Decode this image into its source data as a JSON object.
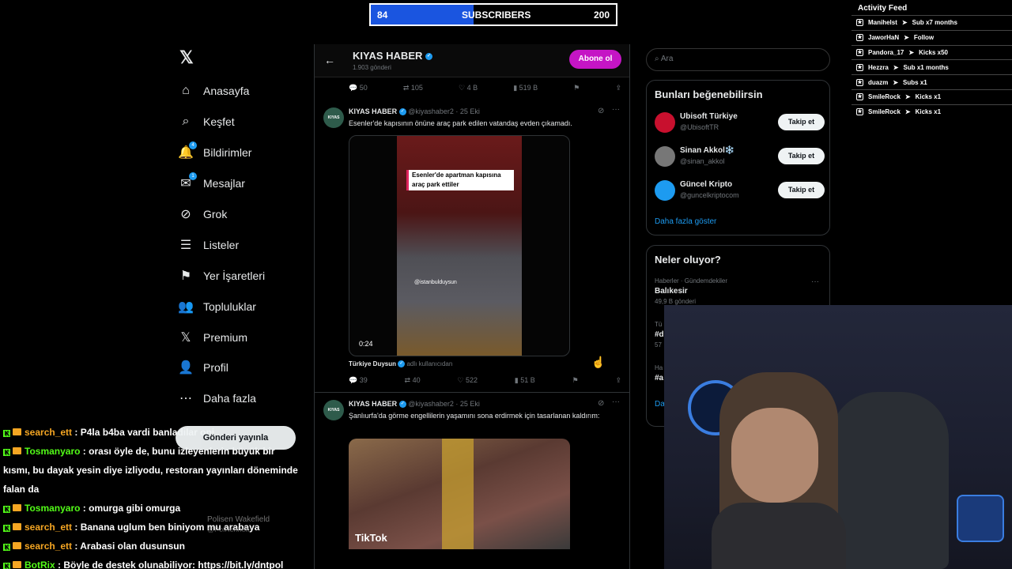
{
  "subscribers": {
    "current": "84",
    "label": "SUBSCRIBERS",
    "goal": "200",
    "progress": 0.42
  },
  "activity_feed": {
    "title": "Activity Feed",
    "items": [
      {
        "user": "Manihelst",
        "text": "Sub x7 months"
      },
      {
        "user": "JaworHaN",
        "text": "Follow"
      },
      {
        "user": "Pandora_17",
        "text": "Kicks x50"
      },
      {
        "user": "Hezzra",
        "text": "Sub x1 months"
      },
      {
        "user": "duazm",
        "text": "Subs x1"
      },
      {
        "user": "SmileRock",
        "text": "Kicks x1"
      },
      {
        "user": "SmileRock",
        "text": "Kicks x1"
      }
    ]
  },
  "nav": {
    "items": [
      {
        "label": "Anasayfa",
        "icon": "home-icon"
      },
      {
        "label": "Keşfet",
        "icon": "search-icon"
      },
      {
        "label": "Bildirimler",
        "icon": "bell-icon",
        "badge": "4"
      },
      {
        "label": "Mesajlar",
        "icon": "mail-icon",
        "badge": "1"
      },
      {
        "label": "Grok",
        "icon": "grok-icon"
      },
      {
        "label": "Listeler",
        "icon": "list-icon"
      },
      {
        "label": "Yer İşaretleri",
        "icon": "bookmark-icon"
      },
      {
        "label": "Topluluklar",
        "icon": "people-icon"
      },
      {
        "label": "Premium",
        "icon": "x-icon"
      },
      {
        "label": "Profil",
        "icon": "person-icon"
      },
      {
        "label": "Daha fazla",
        "icon": "more-icon"
      }
    ],
    "post_button": "Gönderi yayınla",
    "account_name": "Polisen Wakefield",
    "account_handle": "@PolRenhelt"
  },
  "profile_header": {
    "name": "KIYAS HABER",
    "posts": "1.903 gönderi",
    "subscribe": "Abone ol"
  },
  "top_actions": {
    "replies": "50",
    "reposts": "105",
    "likes": "4 B",
    "views": "519 B"
  },
  "tweets": [
    {
      "name": "KIYAS HABER",
      "handle": "@kiyashaber2",
      "date": "· 25 Eki",
      "text": "Esenler'de kapısının önüne araç park edilen vatandaş evden çıkamadı.",
      "video_caption": "Esenler'de apartman kapısına araç park ettiler",
      "watermark": "@istanbulduysun",
      "duration": "0:24",
      "source": "Türkiye Duysun",
      "source_suffix": "adlı kullanıcıdan",
      "replies": "39",
      "reposts": "40",
      "likes": "522",
      "views": "51 B"
    },
    {
      "name": "KIYAS HABER",
      "handle": "@kiyashaber2",
      "date": "· 25 Eki",
      "text": "Şanlıurfa'da görme engellilerin yaşamını sona erdirmek için tasarlanan kaldırım:",
      "media_label": "TikTok"
    }
  ],
  "search": {
    "placeholder": "Ara"
  },
  "suggestions": {
    "title": "Bunları beğenebilirsin",
    "items": [
      {
        "name": "Ubisoft Türkiye",
        "handle": "@UbisoftTR",
        "button": "Takip et",
        "color": "#c8102e"
      },
      {
        "name": "Sinan Akkol❄️",
        "handle": "@sinan_akkol",
        "button": "Takip et",
        "color": "#777777"
      },
      {
        "name": "Güncel Kripto",
        "handle": "@guncelkriptocom",
        "button": "Takip et",
        "color": "#1d9bf0"
      }
    ],
    "more": "Daha fazla göster"
  },
  "trends": {
    "title": "Neler oluyor?",
    "items": [
      {
        "category": "Haberler · Gündemdekiler",
        "name": "Balıkesir",
        "count": "49,9 B gönderi"
      },
      {
        "category": "Tü",
        "name": "#d",
        "count": "57"
      },
      {
        "category": "Ha",
        "name": "#a",
        "count": ""
      }
    ],
    "more": "Da"
  },
  "chat": [
    {
      "user": "search_ett",
      "user_color": "#f5a623",
      "msg": "P4la b4ba vardi banladilar oni"
    },
    {
      "user": "Tosmanyaro",
      "user_color": "#53fc18",
      "msg": "orası öyle de, bunu izleyenlerin büyük bir"
    },
    {
      "user": "",
      "user_color": "#ffffff",
      "msg": "kısmı, bu dayak yesin diye izliyodu, restoran yayınları döneminde"
    },
    {
      "user": "",
      "user_color": "#ffffff",
      "msg": "falan da"
    },
    {
      "user": "Tosmanyaro",
      "user_color": "#53fc18",
      "msg": "omurga gibi omurga"
    },
    {
      "user": "search_ett",
      "user_color": "#f5a623",
      "msg": "Banana uglum ben biniyom mu arabaya"
    },
    {
      "user": "search_ett",
      "user_color": "#f5a623",
      "msg": "Arabasi olan dusunsun"
    },
    {
      "user": "BotRix",
      "user_color": "#53fc18",
      "msg": "Böyle de destek olunabiliyor: https://bit.ly/dntpol"
    }
  ]
}
